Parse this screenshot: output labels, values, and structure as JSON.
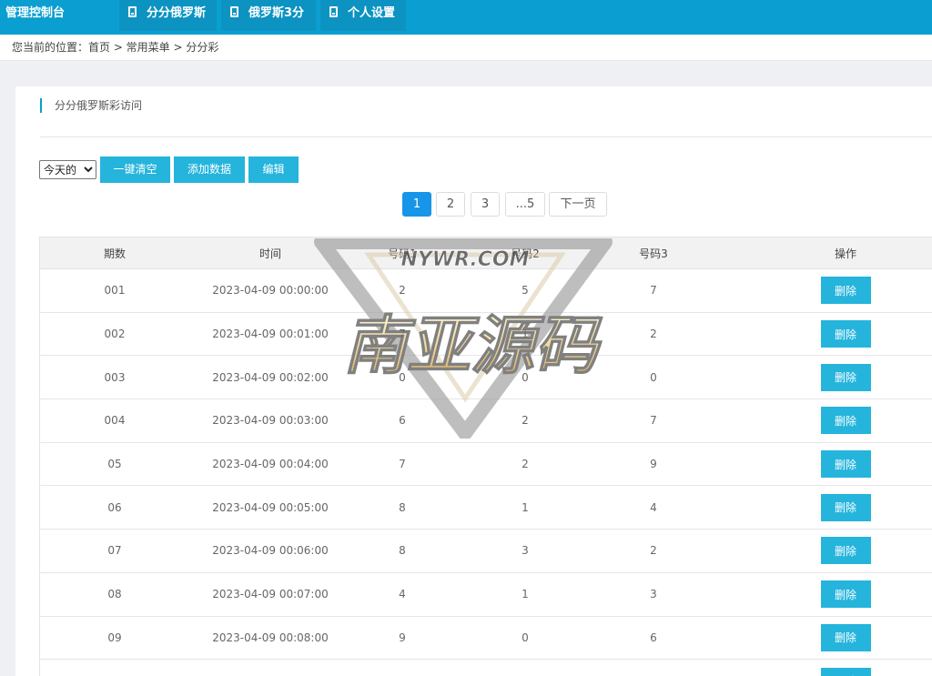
{
  "header": {
    "brand": "管理控制台",
    "tabs": [
      {
        "label": "分分俄罗斯"
      },
      {
        "label": "俄罗斯3分"
      },
      {
        "label": "个人设置"
      }
    ]
  },
  "breadcrumb": "您当前的位置：首页 > 常用菜单 > 分分彩",
  "panel": {
    "title": "分分俄罗斯彩访问"
  },
  "toolbar": {
    "range_options": [
      "今天的"
    ],
    "range_selected": "今天的",
    "clear_label": "一键清空",
    "add_label": "添加数据",
    "edit_label": "编辑"
  },
  "pagination": {
    "pages": [
      "1",
      "2",
      "3",
      "...5"
    ],
    "current": "1",
    "next_label": "下一页"
  },
  "table": {
    "columns": [
      "期数",
      "时间",
      "号码1",
      "号码2",
      "号码3",
      "操作"
    ],
    "delete_label": "删除",
    "rows": [
      {
        "issue": "001",
        "time": "2023-04-09 00:00:00",
        "n1": "2",
        "n2": "5",
        "n3": "7"
      },
      {
        "issue": "002",
        "time": "2023-04-09 00:01:00",
        "n1": "7",
        "n2": "1",
        "n3": "2"
      },
      {
        "issue": "003",
        "time": "2023-04-09 00:02:00",
        "n1": "0",
        "n2": "0",
        "n3": "0"
      },
      {
        "issue": "004",
        "time": "2023-04-09 00:03:00",
        "n1": "6",
        "n2": "2",
        "n3": "7"
      },
      {
        "issue": "05",
        "time": "2023-04-09 00:04:00",
        "n1": "7",
        "n2": "2",
        "n3": "9"
      },
      {
        "issue": "06",
        "time": "2023-04-09 00:05:00",
        "n1": "8",
        "n2": "1",
        "n3": "4"
      },
      {
        "issue": "07",
        "time": "2023-04-09 00:06:00",
        "n1": "8",
        "n2": "3",
        "n3": "2"
      },
      {
        "issue": "08",
        "time": "2023-04-09 00:07:00",
        "n1": "4",
        "n2": "1",
        "n3": "3"
      },
      {
        "issue": "09",
        "time": "2023-04-09 00:08:00",
        "n1": "9",
        "n2": "0",
        "n3": "6"
      },
      {
        "issue": "",
        "time": "",
        "n1": "",
        "n2": "",
        "n3": ""
      }
    ]
  },
  "watermark": {
    "url_text": "NYWR.COM",
    "name_text": "南亚源码"
  }
}
